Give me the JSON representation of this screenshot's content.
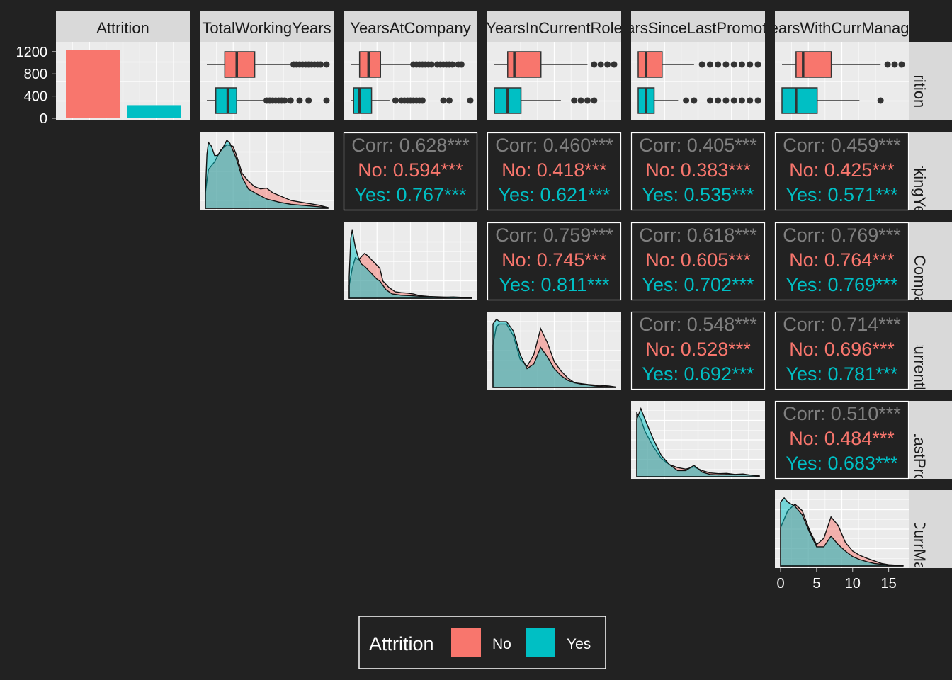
{
  "variables": [
    "Attrition",
    "TotalWorkingYears",
    "YearsAtCompany",
    "YearsInCurrentRole",
    "YearsSinceLastPromotion",
    "YearsWithCurrManager"
  ],
  "colors": {
    "No": "#F8766D",
    "Yes": "#00BFC4",
    "background": "#222222",
    "panel": "#EBEBEB",
    "strip": "#D9D9D9",
    "corr_text": "#7F7F7F"
  },
  "chart_data": [
    {
      "type": "bar",
      "panel": "Attrition",
      "categories": [
        "No",
        "Yes"
      ],
      "values": [
        1233,
        237
      ],
      "yticks": [
        0,
        400,
        800,
        1200
      ],
      "ylim": [
        0,
        1300
      ]
    },
    {
      "type": "box",
      "panel": "Attrition vs years",
      "groups": [
        "No",
        "Yes"
      ],
      "series": [
        {
          "variable": "TotalWorkingYears",
          "No": {
            "lo": 0,
            "q1": 6,
            "med": 10,
            "q3": 16,
            "hi": 28,
            "outliers": [
              29,
              30,
              31,
              32,
              33,
              34,
              35,
              36,
              37,
              38,
              40
            ]
          },
          "Yes": {
            "lo": 0,
            "q1": 3,
            "med": 7,
            "q3": 10,
            "hi": 19,
            "outliers": [
              20,
              21,
              22,
              23,
              24,
              25,
              26,
              28,
              31,
              34,
              40
            ]
          }
        },
        {
          "variable": "YearsAtCompany",
          "No": {
            "lo": 0,
            "q1": 3,
            "med": 6,
            "q3": 10,
            "hi": 20,
            "outliers": [
              21,
              22,
              23,
              24,
              25,
              26,
              27,
              29,
              30,
              31,
              32,
              33,
              34,
              36,
              37
            ]
          },
          "Yes": {
            "lo": 0,
            "q1": 1,
            "med": 3,
            "q3": 7,
            "hi": 13,
            "outliers": [
              15,
              17,
              18,
              19,
              20,
              21,
              22,
              23,
              24,
              31,
              33,
              40
            ]
          }
        },
        {
          "variable": "YearsInCurrentRole",
          "No": {
            "lo": 0,
            "q1": 2,
            "med": 3,
            "q3": 7,
            "hi": 14,
            "outliers": [
              15,
              16,
              17,
              18
            ]
          },
          "Yes": {
            "lo": 0,
            "q1": 0,
            "med": 2,
            "q3": 4,
            "hi": 10,
            "outliers": [
              12,
              13,
              14,
              15
            ]
          }
        },
        {
          "variable": "YearsSinceLastPromotion",
          "No": {
            "lo": 0,
            "q1": 0,
            "med": 1,
            "q3": 3,
            "hi": 7,
            "outliers": [
              8,
              9,
              10,
              11,
              12,
              13,
              14,
              15
            ]
          },
          "Yes": {
            "lo": 0,
            "q1": 0,
            "med": 1,
            "q3": 2,
            "hi": 5,
            "outliers": [
              6,
              7,
              9,
              10,
              11,
              12,
              13,
              14,
              15
            ]
          }
        },
        {
          "variable": "YearsWithCurrManager",
          "No": {
            "lo": 0,
            "q1": 2,
            "med": 3,
            "q3": 7,
            "hi": 14,
            "outliers": [
              15,
              16,
              17
            ]
          },
          "Yes": {
            "lo": 0,
            "q1": 0,
            "med": 2,
            "q3": 5,
            "hi": 11,
            "outliers": [
              14
            ]
          }
        }
      ]
    },
    {
      "type": "area",
      "panel": "density diagonal",
      "series": [
        {
          "variable": "TotalWorkingYears",
          "xlim": [
            0,
            40
          ],
          "No": [
            [
              0,
              0.02
            ],
            [
              1,
              0.05
            ],
            [
              3,
              0.06
            ],
            [
              5,
              0.075
            ],
            [
              7,
              0.082
            ],
            [
              9,
              0.08
            ],
            [
              10,
              0.07
            ],
            [
              12,
              0.045
            ],
            [
              14,
              0.035
            ],
            [
              16,
              0.028
            ],
            [
              18,
              0.025
            ],
            [
              20,
              0.026
            ],
            [
              22,
              0.02
            ],
            [
              25,
              0.015
            ],
            [
              28,
              0.01
            ],
            [
              31,
              0.008
            ],
            [
              34,
              0.006
            ],
            [
              37,
              0.004
            ],
            [
              40,
              0.001
            ]
          ],
          "Yes": [
            [
              0,
              0.02
            ],
            [
              0.5,
              0.07
            ],
            [
              1,
              0.085
            ],
            [
              2,
              0.08
            ],
            [
              3,
              0.068
            ],
            [
              4,
              0.068
            ],
            [
              6,
              0.08
            ],
            [
              7,
              0.088
            ],
            [
              8,
              0.084
            ],
            [
              10,
              0.065
            ],
            [
              12,
              0.04
            ],
            [
              14,
              0.025
            ],
            [
              17,
              0.018
            ],
            [
              20,
              0.012
            ],
            [
              24,
              0.008
            ],
            [
              28,
              0.005
            ],
            [
              34,
              0.003
            ],
            [
              40,
              0.001
            ]
          ]
        },
        {
          "variable": "YearsAtCompany",
          "xlim": [
            0,
            40
          ],
          "No": [
            [
              0,
              0.03
            ],
            [
              1,
              0.07
            ],
            [
              2,
              0.095
            ],
            [
              3,
              0.09
            ],
            [
              5,
              0.105
            ],
            [
              6,
              0.1
            ],
            [
              8,
              0.085
            ],
            [
              10,
              0.07
            ],
            [
              11,
              0.04
            ],
            [
              13,
              0.025
            ],
            [
              15,
              0.015
            ],
            [
              17,
              0.013
            ],
            [
              19,
              0.012
            ],
            [
              21,
              0.01
            ],
            [
              23,
              0.006
            ],
            [
              26,
              0.004
            ],
            [
              30,
              0.003
            ],
            [
              34,
              0.002
            ],
            [
              40,
              0.001
            ]
          ],
          "Yes": [
            [
              0,
              0.05
            ],
            [
              0.5,
              0.14
            ],
            [
              1,
              0.16
            ],
            [
              2,
              0.12
            ],
            [
              3,
              0.095
            ],
            [
              4,
              0.08
            ],
            [
              5,
              0.075
            ],
            [
              7,
              0.06
            ],
            [
              9,
              0.045
            ],
            [
              10,
              0.04
            ],
            [
              12,
              0.02
            ],
            [
              14,
              0.01
            ],
            [
              17,
              0.007
            ],
            [
              20,
              0.006
            ],
            [
              24,
              0.004
            ],
            [
              30,
              0.002
            ],
            [
              34,
              0.003
            ],
            [
              40,
              0.001
            ]
          ]
        },
        {
          "variable": "YearsInCurrentRole",
          "xlim": [
            0,
            18
          ],
          "No": [
            [
              0,
              0.09
            ],
            [
              0.5,
              0.13
            ],
            [
              1,
              0.135
            ],
            [
              2,
              0.135
            ],
            [
              3,
              0.11
            ],
            [
              4,
              0.06
            ],
            [
              5,
              0.045
            ],
            [
              6,
              0.07
            ],
            [
              7,
              0.125
            ],
            [
              8,
              0.095
            ],
            [
              9,
              0.055
            ],
            [
              10,
              0.035
            ],
            [
              11,
              0.02
            ],
            [
              12,
              0.01
            ],
            [
              13,
              0.008
            ],
            [
              14,
              0.006
            ],
            [
              15,
              0.005
            ],
            [
              16,
              0.004
            ],
            [
              17,
              0.003
            ],
            [
              18,
              0.001
            ]
          ],
          "Yes": [
            [
              0,
              0.135
            ],
            [
              0.5,
              0.145
            ],
            [
              1,
              0.14
            ],
            [
              2,
              0.14
            ],
            [
              3,
              0.12
            ],
            [
              4,
              0.07
            ],
            [
              5,
              0.04
            ],
            [
              6,
              0.05
            ],
            [
              7,
              0.085
            ],
            [
              8,
              0.065
            ],
            [
              9,
              0.04
            ],
            [
              10,
              0.025
            ],
            [
              11,
              0.015
            ],
            [
              12,
              0.01
            ],
            [
              13,
              0.007
            ],
            [
              14,
              0.005
            ],
            [
              15,
              0.003
            ],
            [
              16,
              0.002
            ],
            [
              17,
              0.001
            ],
            [
              18,
              0
            ]
          ]
        },
        {
          "variable": "YearsSinceLastPromotion",
          "xlim": [
            0,
            15
          ],
          "No": [
            [
              0,
              0.42
            ],
            [
              0.5,
              0.38
            ],
            [
              1,
              0.3
            ],
            [
              2,
              0.2
            ],
            [
              3,
              0.12
            ],
            [
              4,
              0.08
            ],
            [
              5,
              0.06
            ],
            [
              6,
              0.05
            ],
            [
              7,
              0.065
            ],
            [
              8,
              0.04
            ],
            [
              9,
              0.025
            ],
            [
              10,
              0.02
            ],
            [
              11,
              0.022
            ],
            [
              12,
              0.015
            ],
            [
              13,
              0.018
            ],
            [
              14,
              0.01
            ],
            [
              15,
              0.005
            ]
          ],
          "Yes": [
            [
              0,
              0.38
            ],
            [
              0.5,
              0.45
            ],
            [
              1,
              0.38
            ],
            [
              2,
              0.25
            ],
            [
              3,
              0.14
            ],
            [
              4,
              0.08
            ],
            [
              5,
              0.04
            ],
            [
              6,
              0.04
            ],
            [
              7,
              0.075
            ],
            [
              8,
              0.03
            ],
            [
              9,
              0.015
            ],
            [
              10,
              0.012
            ],
            [
              11,
              0.015
            ],
            [
              12,
              0.012
            ],
            [
              13,
              0.014
            ],
            [
              14,
              0.01
            ],
            [
              15,
              0.005
            ]
          ]
        },
        {
          "variable": "YearsWithCurrManager",
          "xlim": [
            0,
            17
          ],
          "No": [
            [
              0,
              0.09
            ],
            [
              1,
              0.13
            ],
            [
              2,
              0.145
            ],
            [
              3,
              0.13
            ],
            [
              4,
              0.085
            ],
            [
              5,
              0.05
            ],
            [
              6,
              0.065
            ],
            [
              7,
              0.115
            ],
            [
              8,
              0.095
            ],
            [
              9,
              0.055
            ],
            [
              10,
              0.035
            ],
            [
              11,
              0.025
            ],
            [
              12,
              0.018
            ],
            [
              13,
              0.012
            ],
            [
              14,
              0.006
            ],
            [
              15,
              0.003
            ],
            [
              16,
              0.002
            ],
            [
              17,
              0.001
            ]
          ],
          "Yes": [
            [
              0,
              0.15
            ],
            [
              0.5,
              0.16
            ],
            [
              1,
              0.15
            ],
            [
              2,
              0.14
            ],
            [
              3,
              0.12
            ],
            [
              4,
              0.08
            ],
            [
              5,
              0.045
            ],
            [
              6,
              0.045
            ],
            [
              7,
              0.07
            ],
            [
              8,
              0.05
            ],
            [
              9,
              0.035
            ],
            [
              10,
              0.022
            ],
            [
              11,
              0.015
            ],
            [
              12,
              0.01
            ],
            [
              13,
              0.006
            ],
            [
              14,
              0.004
            ],
            [
              15,
              0.002
            ],
            [
              16,
              0.001
            ],
            [
              17,
              0
            ]
          ]
        }
      ]
    },
    {
      "type": "table",
      "panel": "correlations upper",
      "cells": [
        {
          "row": "TotalWorkingYears",
          "col": "YearsAtCompany",
          "corr": "Corr: 0.628***",
          "no": "No: 0.594***",
          "yes": "Yes: 0.767***"
        },
        {
          "row": "TotalWorkingYears",
          "col": "YearsInCurrentRole",
          "corr": "Corr: 0.460***",
          "no": "No: 0.418***",
          "yes": "Yes: 0.621***"
        },
        {
          "row": "TotalWorkingYears",
          "col": "YearsSinceLastPromotion",
          "corr": "Corr: 0.405***",
          "no": "No: 0.383***",
          "yes": "Yes: 0.535***"
        },
        {
          "row": "TotalWorkingYears",
          "col": "YearsWithCurrManager",
          "corr": "Corr: 0.459***",
          "no": "No: 0.425***",
          "yes": "Yes: 0.571***"
        },
        {
          "row": "YearsAtCompany",
          "col": "YearsInCurrentRole",
          "corr": "Corr: 0.759***",
          "no": "No: 0.745***",
          "yes": "Yes: 0.811***"
        },
        {
          "row": "YearsAtCompany",
          "col": "YearsSinceLastPromotion",
          "corr": "Corr: 0.618***",
          "no": "No: 0.605***",
          "yes": "Yes: 0.702***"
        },
        {
          "row": "YearsAtCompany",
          "col": "YearsWithCurrManager",
          "corr": "Corr: 0.769***",
          "no": "No: 0.764***",
          "yes": "Yes: 0.769***"
        },
        {
          "row": "YearsInCurrentRole",
          "col": "YearsSinceLastPromotion",
          "corr": "Corr: 0.548***",
          "no": "No: 0.528***",
          "yes": "Yes: 0.692***"
        },
        {
          "row": "YearsInCurrentRole",
          "col": "YearsWithCurrManager",
          "corr": "Corr: 0.714***",
          "no": "No: 0.696***",
          "yes": "Yes: 0.781***"
        },
        {
          "row": "YearsSinceLastPromotion",
          "col": "YearsWithCurrManager",
          "corr": "Corr: 0.510***",
          "no": "No: 0.484***",
          "yes": "Yes: 0.683***"
        }
      ]
    }
  ],
  "bottom_axis": {
    "ticks": [
      "0",
      "5",
      "10",
      "15"
    ],
    "xlim": [
      0,
      17
    ]
  },
  "legend": {
    "title": "Attrition",
    "items": [
      "No",
      "Yes"
    ]
  }
}
